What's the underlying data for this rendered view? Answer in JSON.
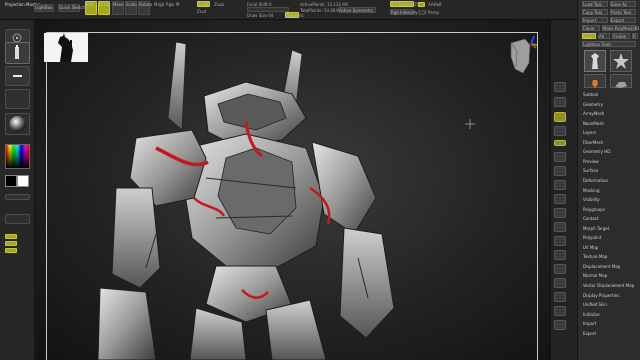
{
  "app": {
    "lightbox_title": "Projection Master"
  },
  "top": {
    "buttons": [
      "LightBox",
      "Quick Sketch",
      "Edit",
      "Draw",
      "Move",
      "Scale",
      "Rotate"
    ],
    "labels": [
      "Mrgb",
      "Rgb",
      "M",
      "Zadd",
      "Zsub",
      "Focal Shift",
      "Draw Size",
      "Dynamic",
      "ActivePoints:",
      "TotalPoints:",
      "Zcut",
      "Z Intensity",
      "Rgb Intensity"
    ],
    "values": [
      "",
      "",
      "",
      "",
      "",
      "0",
      "64",
      "",
      "12.122 Mil",
      "54.664 Mil",
      "",
      "25",
      "100"
    ],
    "active_symmetry_label": "Active Symmetry",
    "right_labels": [
      "AAHalf",
      "Persp",
      "Floor",
      "Local"
    ]
  },
  "left": {
    "labels": [
      "Stroke",
      "Alpha",
      "Texture",
      "Material",
      "Color",
      "SwitchColor",
      "Gradient",
      "Alternate"
    ]
  },
  "right_strip": {
    "icons": [
      "scroll-icon",
      "zoom-icon",
      "actual-icon",
      "aahalf-icon",
      "persp-icon",
      "floor-icon",
      "local-icon",
      "lsym-icon",
      "xyz-icon",
      "frame-icon",
      "move-icon",
      "zoom3d-icon",
      "rotate-icon",
      "poly-f-icon",
      "transp-icon",
      "ghost-icon",
      "solo-icon",
      "xpose-icon"
    ]
  },
  "right_panel": {
    "top_labels": [
      "Load Tool",
      "Save As",
      "Copy Tool",
      "Paste Tool",
      "Import",
      "Export",
      "Clone",
      "Make PolyMesh3D",
      "GoZ",
      "All",
      "Visible",
      "R",
      "Lightbox",
      "Tools"
    ],
    "tool_names": [
      "SimpleBrush",
      "PM3D_Star",
      "PolyMesh3D",
      "Dinosaur"
    ],
    "menu": [
      "Subtool",
      "Geometry",
      "ArrayMesh",
      "NanoMesh",
      "Layers",
      "FiberMesh",
      "Geometry HD",
      "Preview",
      "Surface",
      "Deformation",
      "Masking",
      "Visibility",
      "Polygroups",
      "Contact",
      "Morph Target",
      "Polypaint",
      "UV Map",
      "Texture Map",
      "Displacement Map",
      "Normal Map",
      "Vector Displacement Map",
      "Display Properties",
      "Unified Skin",
      "Initialize",
      "Import",
      "Export"
    ]
  },
  "colors": {
    "accent_yellow": "#a7a71a",
    "highlight_red": "#c4181c"
  }
}
